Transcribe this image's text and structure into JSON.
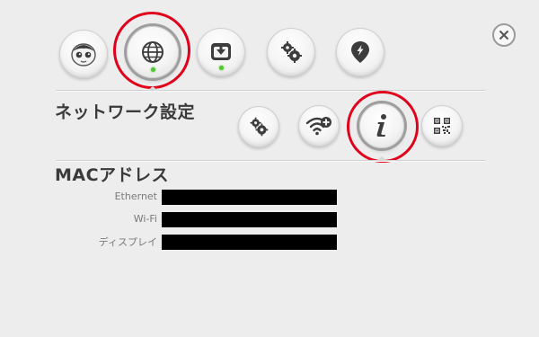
{
  "top_nav": [
    {
      "key": "robot",
      "icon": "robot-face-icon"
    },
    {
      "key": "network",
      "icon": "globe-icon",
      "selected": true,
      "status": "connected"
    },
    {
      "key": "download",
      "icon": "download-icon",
      "status": "connected"
    },
    {
      "key": "settings",
      "icon": "gears-icon"
    },
    {
      "key": "location",
      "icon": "location-pin-icon"
    }
  ],
  "close_icon": "close-icon",
  "section": {
    "title": "ネットワーク設定"
  },
  "sub_nav": [
    {
      "key": "network-settings",
      "icon": "gears-icon"
    },
    {
      "key": "wifi-add",
      "icon": "wifi-add-icon"
    },
    {
      "key": "info",
      "icon": "info-icon",
      "selected": true
    },
    {
      "key": "qr",
      "icon": "qr-code-icon"
    }
  ],
  "mac": {
    "title": "MACアドレス",
    "rows": [
      {
        "label": "Ethernet",
        "value": ""
      },
      {
        "label": "Wi-Fi",
        "value": ""
      },
      {
        "label": "ディスプレイ",
        "value": ""
      }
    ]
  },
  "colors": {
    "background": "#ededed",
    "highlight": "#e0001b",
    "status_green": "#55c434",
    "icon_dark": "#3d3d3d",
    "redaction": "#000000"
  }
}
